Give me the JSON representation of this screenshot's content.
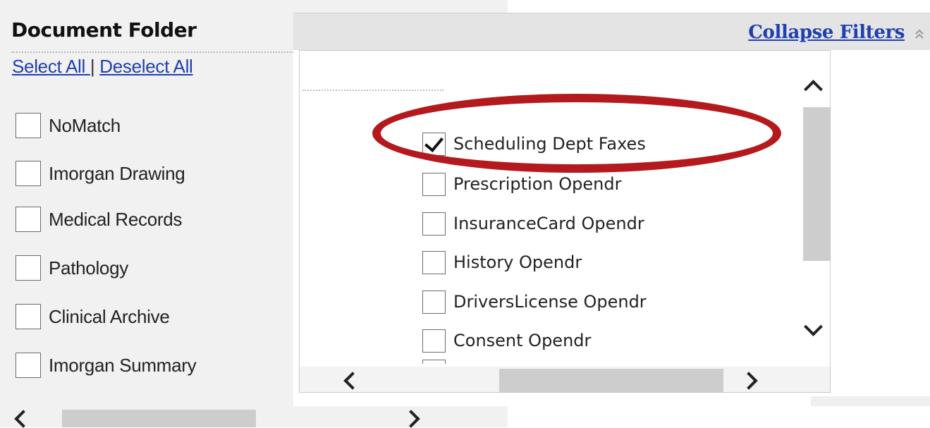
{
  "left_panel": {
    "title": "Document Folder",
    "select_all": "Select All ",
    "separator": "|",
    "deselect_all": "Deselect All",
    "items": [
      {
        "label": "NoMatch",
        "checked": false
      },
      {
        "label": "Imorgan Drawing",
        "checked": false
      },
      {
        "label": "Medical Records",
        "checked": false
      },
      {
        "label": "Pathology",
        "checked": false
      },
      {
        "label": "Clinical Archive",
        "checked": false
      },
      {
        "label": "Imorgan Summary",
        "checked": false
      }
    ]
  },
  "filter_panel": {
    "collapse_label": "Collapse Filters",
    "collapse_icon": "double-chevron-up-icon",
    "items": [
      {
        "label": "Scheduling Dept Faxes",
        "checked": true
      },
      {
        "label": "Prescription Opendr",
        "checked": false
      },
      {
        "label": "InsuranceCard Opendr",
        "checked": false
      },
      {
        "label": "History Opendr",
        "checked": false
      },
      {
        "label": "DriversLicense Opendr",
        "checked": false
      },
      {
        "label": "Consent Opendr",
        "checked": false
      }
    ]
  },
  "annotation": {
    "highlight_color": "#b4191d",
    "highlighted_item": "Scheduling Dept Faxes"
  },
  "colors": {
    "link": "#1f3fb0",
    "panel_bg": "#f1f1f1",
    "header_bg": "#e4e4e4",
    "scroll_thumb": "#cdcdcd"
  }
}
